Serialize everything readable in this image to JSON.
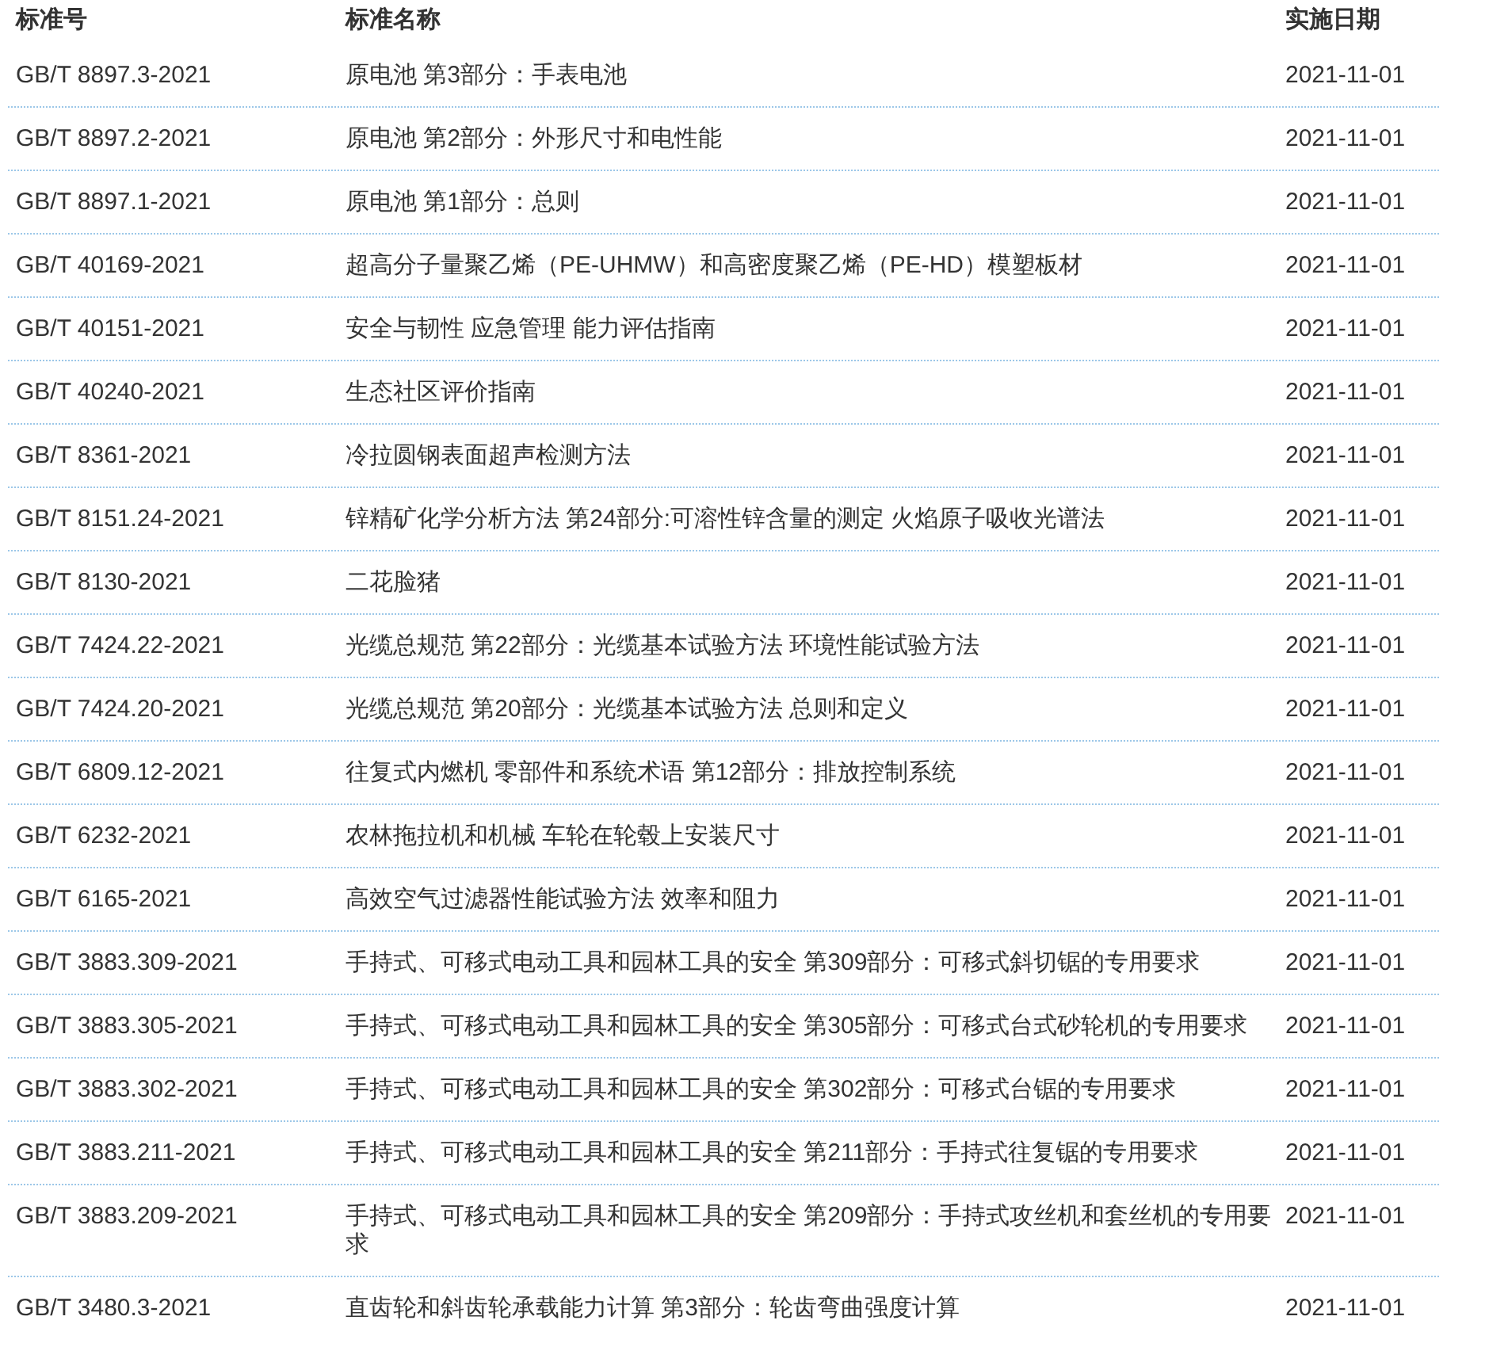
{
  "table": {
    "columns": [
      "标准号",
      "标准名称",
      "实施日期"
    ],
    "rows": [
      {
        "number": "GB/T 8897.3-2021",
        "name": "原电池 第3部分：手表电池",
        "date": "2021-11-01"
      },
      {
        "number": "GB/T 8897.2-2021",
        "name": "原电池 第2部分：外形尺寸和电性能",
        "date": "2021-11-01"
      },
      {
        "number": "GB/T 8897.1-2021",
        "name": "原电池 第1部分：总则",
        "date": "2021-11-01"
      },
      {
        "number": "GB/T 40169-2021",
        "name": "超高分子量聚乙烯（PE-UHMW）和高密度聚乙烯（PE-HD）模塑板材",
        "date": "2021-11-01"
      },
      {
        "number": "GB/T 40151-2021",
        "name": "安全与韧性 应急管理 能力评估指南",
        "date": "2021-11-01"
      },
      {
        "number": "GB/T 40240-2021",
        "name": "生态社区评价指南",
        "date": "2021-11-01"
      },
      {
        "number": "GB/T 8361-2021",
        "name": "冷拉圆钢表面超声检测方法",
        "date": "2021-11-01"
      },
      {
        "number": "GB/T 8151.24-2021",
        "name": "锌精矿化学分析方法 第24部分:可溶性锌含量的测定 火焰原子吸收光谱法",
        "date": "2021-11-01"
      },
      {
        "number": "GB/T 8130-2021",
        "name": "二花脸猪",
        "date": "2021-11-01"
      },
      {
        "number": "GB/T 7424.22-2021",
        "name": "光缆总规范 第22部分：光缆基本试验方法 环境性能试验方法",
        "date": "2021-11-01"
      },
      {
        "number": "GB/T 7424.20-2021",
        "name": "光缆总规范 第20部分：光缆基本试验方法 总则和定义",
        "date": "2021-11-01"
      },
      {
        "number": "GB/T 6809.12-2021",
        "name": "往复式内燃机 零部件和系统术语 第12部分：排放控制系统",
        "date": "2021-11-01"
      },
      {
        "number": "GB/T 6232-2021",
        "name": "农林拖拉机和机械 车轮在轮毂上安装尺寸",
        "date": "2021-11-01"
      },
      {
        "number": "GB/T 6165-2021",
        "name": "高效空气过滤器性能试验方法 效率和阻力",
        "date": "2021-11-01"
      },
      {
        "number": "GB/T 3883.309-2021",
        "name": "手持式、可移式电动工具和园林工具的安全 第309部分：可移式斜切锯的专用要求",
        "date": "2021-11-01"
      },
      {
        "number": "GB/T 3883.305-2021",
        "name": "手持式、可移式电动工具和园林工具的安全 第305部分：可移式台式砂轮机的专用要求",
        "date": "2021-11-01"
      },
      {
        "number": "GB/T 3883.302-2021",
        "name": "手持式、可移式电动工具和园林工具的安全 第302部分：可移式台锯的专用要求",
        "date": "2021-11-01"
      },
      {
        "number": "GB/T 3883.211-2021",
        "name": "手持式、可移式电动工具和园林工具的安全 第211部分：手持式往复锯的专用要求",
        "date": "2021-11-01"
      },
      {
        "number": "GB/T 3883.209-2021",
        "name": "手持式、可移式电动工具和园林工具的安全 第209部分：手持式攻丝机和套丝机的专用要求",
        "date": "2021-11-01"
      },
      {
        "number": "GB/T 3480.3-2021",
        "name": "直齿轮和斜齿轮承载能力计算 第3部分：轮齿弯曲强度计算",
        "date": "2021-11-01"
      }
    ]
  }
}
